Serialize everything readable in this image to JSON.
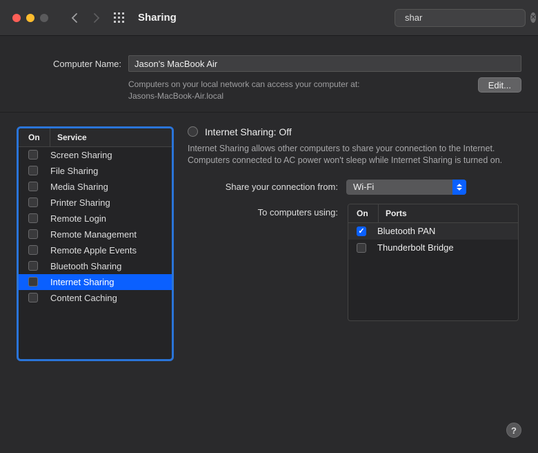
{
  "window": {
    "title": "Sharing",
    "search_value": "shar"
  },
  "computer_name": {
    "label": "Computer Name:",
    "value": "Jason's MacBook Air",
    "description_line1": "Computers on your local network can access your computer at:",
    "description_line2": "Jasons-MacBook-Air.local",
    "edit_button": "Edit..."
  },
  "services": {
    "header_on": "On",
    "header_service": "Service",
    "items": [
      {
        "label": "Screen Sharing",
        "on": false,
        "selected": false
      },
      {
        "label": "File Sharing",
        "on": false,
        "selected": false
      },
      {
        "label": "Media Sharing",
        "on": false,
        "selected": false
      },
      {
        "label": "Printer Sharing",
        "on": false,
        "selected": false
      },
      {
        "label": "Remote Login",
        "on": false,
        "selected": false
      },
      {
        "label": "Remote Management",
        "on": false,
        "selected": false
      },
      {
        "label": "Remote Apple Events",
        "on": false,
        "selected": false
      },
      {
        "label": "Bluetooth Sharing",
        "on": false,
        "selected": false
      },
      {
        "label": "Internet Sharing",
        "on": false,
        "selected": true
      },
      {
        "label": "Content Caching",
        "on": false,
        "selected": false
      }
    ]
  },
  "detail": {
    "title": "Internet Sharing: Off",
    "description": "Internet Sharing allows other computers to share your connection to the Internet. Computers connected to AC power won't sleep while Internet Sharing is turned on.",
    "share_from_label": "Share your connection from:",
    "share_from_value": "Wi-Fi",
    "to_computers_label": "To computers using:",
    "ports_header_on": "On",
    "ports_header_ports": "Ports",
    "ports": [
      {
        "label": "Bluetooth PAN",
        "on": true
      },
      {
        "label": "Thunderbolt Bridge",
        "on": false
      }
    ]
  },
  "help": "?"
}
